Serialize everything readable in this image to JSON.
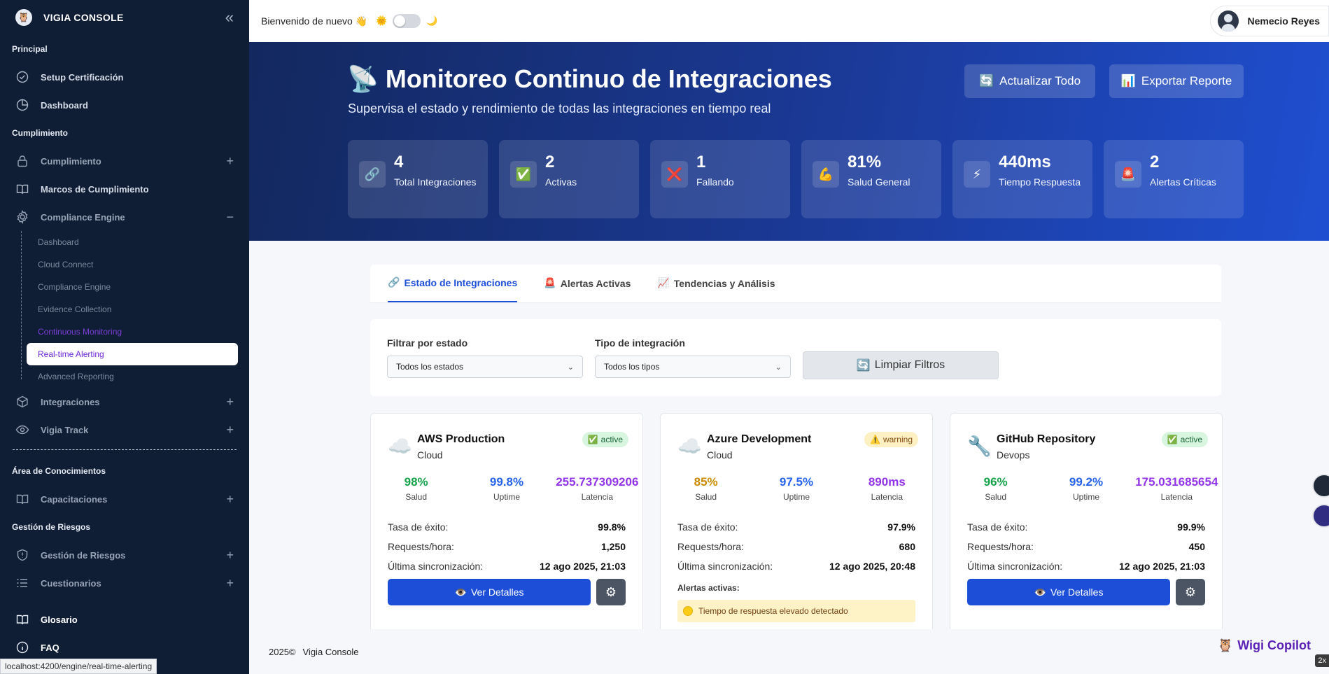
{
  "sidebar": {
    "brand": "VIGIA CONSOLE",
    "sections": {
      "principal": "Principal",
      "cumplimiento": "Cumplimiento",
      "conocimientos": "Área de Conocimientos",
      "riesgos": "Gestión de Riesgos"
    },
    "items": {
      "setup": "Setup Certificación",
      "dashboard": "Dashboard",
      "cumplimiento": "Cumplimiento",
      "marcos": "Marcos de Cumplimiento",
      "compliance_engine": "Compliance Engine",
      "integraciones": "Integraciones",
      "vigia_track": "Vigia Track",
      "capacitaciones": "Capacitaciones",
      "gestion_riesgos": "Gestión de Riesgos",
      "cuestionarios": "Cuestionarios",
      "glosario": "Glosario",
      "faq": "FAQ"
    },
    "sub_items": [
      "Dashboard",
      "Cloud Connect",
      "Compliance Engine",
      "Evidence Collection",
      "Continuous Monitoring",
      "Real-time Alerting",
      "Advanced Reporting"
    ],
    "url_tooltip": "localhost:4200/engine/real-time-alerting"
  },
  "topbar": {
    "welcome": "Bienvenido de nuevo 👋",
    "sun": "🌞",
    "moon": "🌙",
    "user": "Nemecio Reyes"
  },
  "hero": {
    "icon": "📡",
    "title": "Monitoreo Continuo de Integraciones",
    "subtitle": "Supervisa el estado y rendimiento de todas las integraciones en tiempo real",
    "refresh_icon": "🔄",
    "refresh_label": "Actualizar Todo",
    "export_icon": "📊",
    "export_label": "Exportar Reporte",
    "stats": [
      {
        "icon": "🔗",
        "value": "4",
        "label": "Total Integraciones"
      },
      {
        "icon": "✅",
        "value": "2",
        "label": "Activas"
      },
      {
        "icon": "❌",
        "value": "1",
        "label": "Fallando"
      },
      {
        "icon": "💪",
        "value": "81%",
        "label": "Salud General"
      },
      {
        "icon": "⚡",
        "value": "440ms",
        "label": "Tiempo Respuesta"
      },
      {
        "icon": "🚨",
        "value": "2",
        "label": "Alertas Críticas"
      }
    ]
  },
  "tabs": [
    {
      "icon": "🔗",
      "label": "Estado de Integraciones"
    },
    {
      "icon": "🚨",
      "label": "Alertas Activas"
    },
    {
      "icon": "📈",
      "label": "Tendencias y Análisis"
    }
  ],
  "filters": {
    "estado_label": "Filtrar por estado",
    "estado_value": "Todos los estados",
    "tipo_label": "Tipo de integración",
    "tipo_value": "Todos los tipos",
    "clear_icon": "🔄",
    "clear_label": "Limpiar Filtros"
  },
  "labels": {
    "salud": "Salud",
    "uptime": "Uptime",
    "latencia": "Latencia",
    "tasa": "Tasa de éxito:",
    "requests": "Requests/hora:",
    "sync": "Última sincronización:",
    "details": "Ver Detalles",
    "details_icon": "👁️",
    "alerts_title": "Alertas activas:"
  },
  "cards": [
    {
      "icon": "☁️",
      "name": "AWS Production",
      "type": "Cloud",
      "status": "active",
      "status_icon": "✅",
      "salud": "98%",
      "uptime": "99.8%",
      "latencia": "255.737309206",
      "tasa": "99.8%",
      "requests": "1,250",
      "sync": "12 ago 2025, 21:03"
    },
    {
      "icon": "☁️",
      "name": "Azure Development",
      "type": "Cloud",
      "status": "warning",
      "status_icon": "⚠️",
      "salud": "85%",
      "uptime": "97.5%",
      "latencia": "890ms",
      "tasa": "97.9%",
      "requests": "680",
      "sync": "12 ago 2025, 20:48",
      "alert": "Tiempo de respuesta elevado detectado"
    },
    {
      "icon": "🔧",
      "name": "GitHub Repository",
      "type": "Devops",
      "status": "active",
      "status_icon": "✅",
      "salud": "96%",
      "uptime": "99.2%",
      "latencia": "175.031685654",
      "tasa": "99.9%",
      "requests": "450",
      "sync": "12 ago 2025, 21:03"
    }
  ],
  "colors": {
    "salud_good": "#16a34a",
    "salud_warn": "#ca8a04",
    "uptime": "#2563eb",
    "latencia": "#9333ea",
    "primary": "#1d4ed8"
  },
  "footer": {
    "copyright": "2025©",
    "company": "Vigia Console",
    "copilot_icon": "🦉",
    "copilot": "Wigi Copilot",
    "zoom": "2x"
  }
}
